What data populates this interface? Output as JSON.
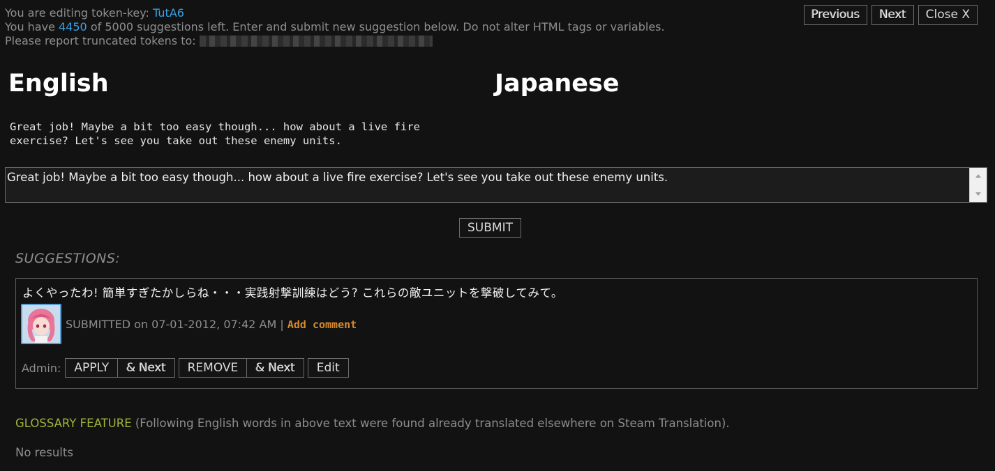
{
  "header": {
    "editing_prefix": "You are editing token-key: ",
    "token_key": "TutA6",
    "suggestions_prefix": "You have ",
    "suggestions_left": "4450",
    "suggestions_suffix": " of 5000 suggestions left. Enter and submit new suggestion below. Do not alter HTML tags or variables.",
    "report_text": "Please report truncated tokens to: "
  },
  "nav": {
    "previous_label": "Previous",
    "next_label": "Next",
    "close_label": "Close X"
  },
  "columns": {
    "source_heading": "English",
    "target_heading": "Japanese"
  },
  "source_text": "Great job! Maybe a bit too easy though... how about a live fire\nexercise? Let's see you take out these enemy units.",
  "editor": {
    "value": "Great job! Maybe a bit too easy though... how about a live fire exercise? Let's see you take out these enemy units."
  },
  "submit_label": "SUBMIT",
  "suggestions": {
    "heading": "SUGGESTIONS:",
    "items": [
      {
        "text": "よくやったわ! 簡単すぎたかしらね・・・実践射撃訓練はどう? これらの敵ユニットを撃破してみて。",
        "submitted": "SUBMITTED on 07-01-2012, 07:42 AM",
        "separator": " | ",
        "add_comment": "Add comment",
        "admin_label": "Admin:",
        "apply_label": "APPLY",
        "apply_next_label": "& Next",
        "remove_label": "REMOVE",
        "remove_next_label": "& Next",
        "edit_label": "Edit"
      }
    ]
  },
  "glossary": {
    "title": "GLOSSARY FEATURE",
    "description": " (Following English words in above text were found already translated elsewhere on Steam Translation).",
    "results": "No results"
  },
  "colors": {
    "background": "#121212",
    "highlight_blue": "#36a3e6",
    "comment_orange": "#d88a2c",
    "glossary_green": "#a0b43a"
  }
}
